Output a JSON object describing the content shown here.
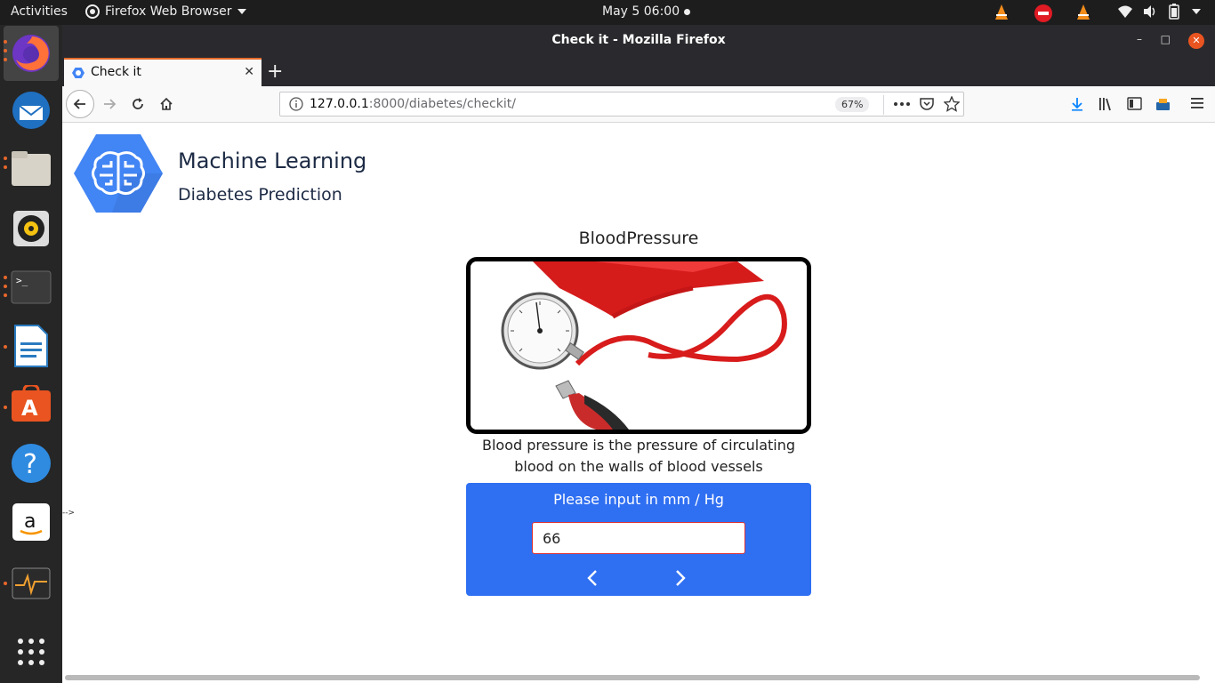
{
  "topbar": {
    "activities": "Activities",
    "app_name": "Firefox Web Browser",
    "clock": "May 5  06:00"
  },
  "window": {
    "title": "Check it - Mozilla Firefox"
  },
  "tab": {
    "title": "Check it"
  },
  "urlbar": {
    "host": "127.0.0.1",
    "rest": ":8000/diabetes/checkit/",
    "zoom": "67%"
  },
  "page": {
    "brand_title": "Machine Learning",
    "brand_subtitle": "Diabetes Prediction",
    "field_title": "BloodPressure",
    "field_description": "Blood pressure is the pressure of circulating blood on the walls of blood vessels",
    "input_prompt": "Please input in mm / Hg",
    "input_value": "66",
    "stray_text": "-->"
  },
  "colors": {
    "accent_blue": "#2f6ff2",
    "logo_blue": "#4285f4",
    "tab_highlight": "#e66b2c",
    "ubuntu_orange": "#e95420"
  },
  "dock": {
    "items": [
      "firefox-icon",
      "thunderbird-icon",
      "files-icon",
      "rhythmbox-icon",
      "terminal-icon",
      "libreoffice-writer-icon",
      "software-center-icon",
      "help-icon",
      "amazon-icon",
      "system-monitor-icon",
      "app-grid-icon"
    ]
  }
}
